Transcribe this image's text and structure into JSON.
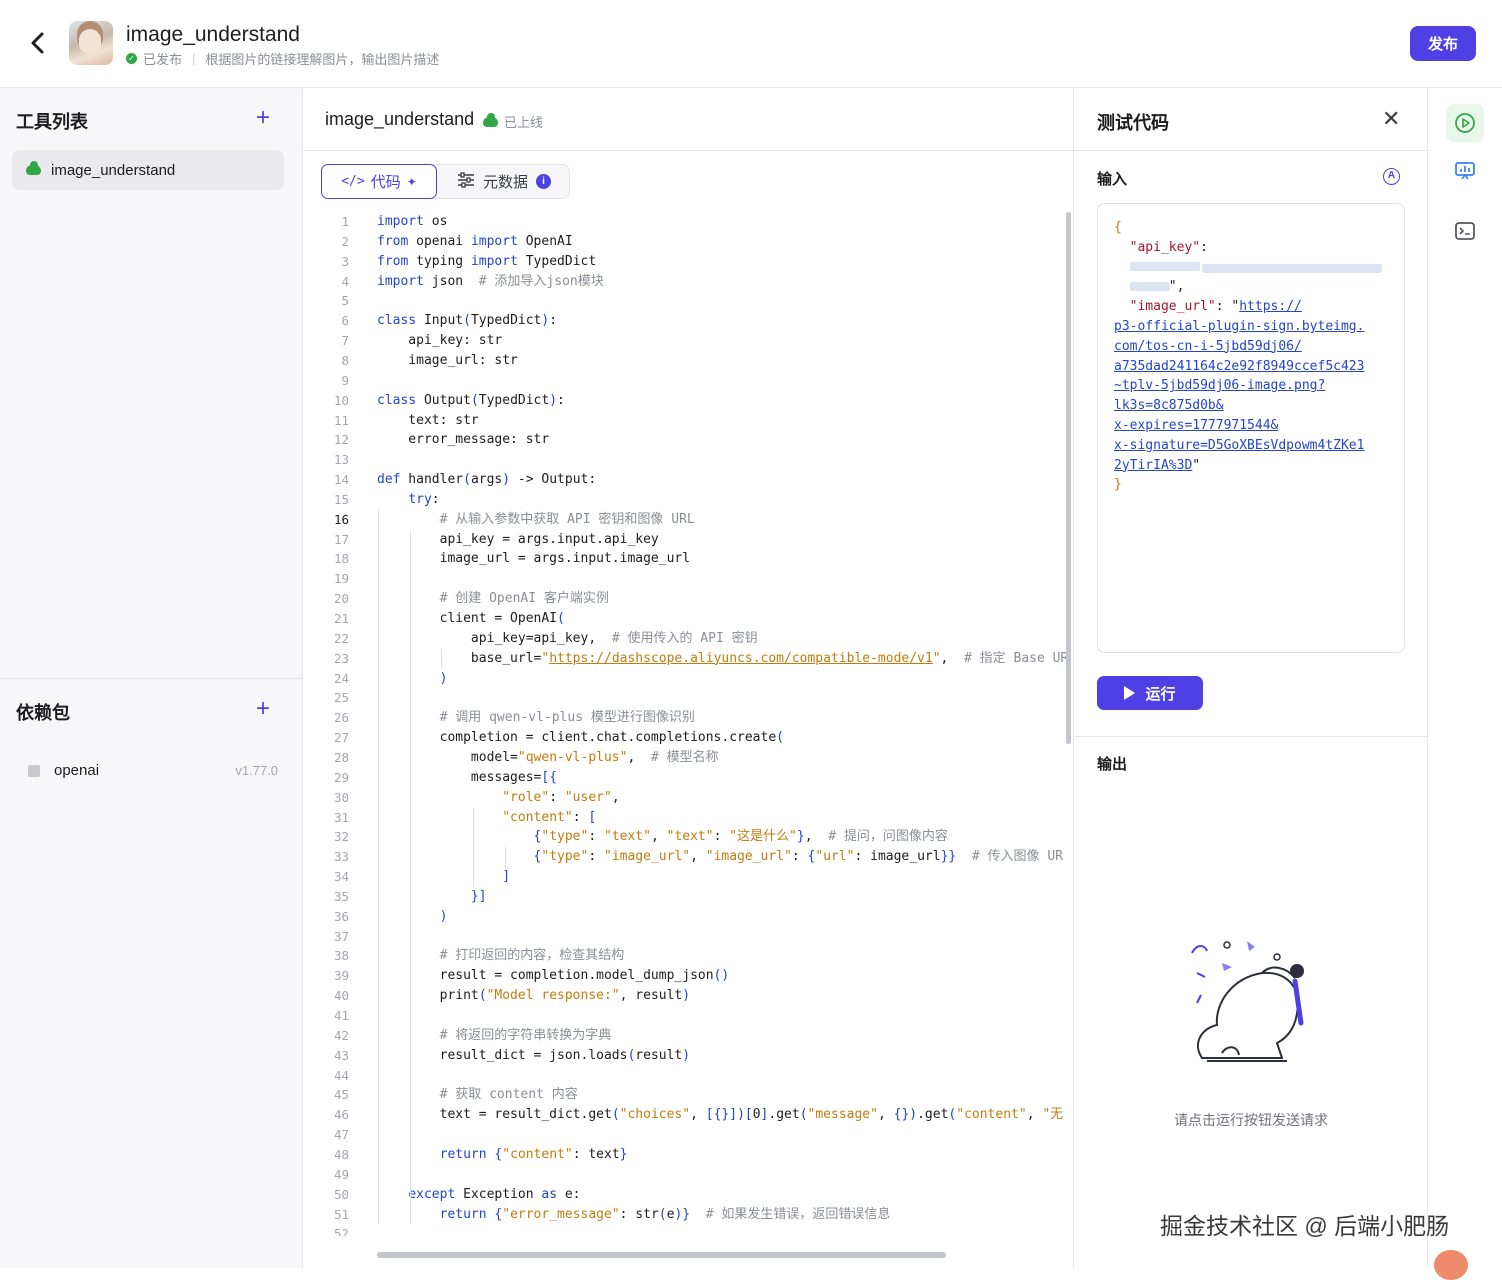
{
  "header": {
    "back_icon": "back-arrow-icon",
    "title": "image_understand",
    "status": "已发布",
    "description": "根据图片的链接理解图片，输出图片描述",
    "publish_label": "发布"
  },
  "sidebar": {
    "tools_title": "工具列表",
    "tools": [
      {
        "label": "image_understand"
      }
    ],
    "deps_title": "依赖包",
    "deps": [
      {
        "name": "openai",
        "version": "v1.77.0"
      }
    ]
  },
  "editor": {
    "title": "image_understand",
    "status": "已上线",
    "tab_code": "代码",
    "tab_meta": "元数据",
    "current_line": 16,
    "lines": [
      "import os",
      "from openai import OpenAI",
      "from typing import TypedDict",
      "import json  # 添加导入json模块",
      "",
      "class Input(TypedDict):",
      "    api_key: str",
      "    image_url: str",
      "",
      "class Output(TypedDict):",
      "    text: str",
      "    error_message: str",
      "",
      "def handler(args) -> Output:",
      "    try:",
      "        # 从输入参数中获取 API 密钥和图像 URL",
      "        api_key = args.input.api_key",
      "        image_url = args.input.image_url",
      "",
      "        # 创建 OpenAI 客户端实例",
      "        client = OpenAI(",
      "            api_key=api_key,  # 使用传入的 API 密钥",
      "            base_url=\"https://dashscope.aliyuncs.com/compatible-mode/v1\",  # 指定 Base UR",
      "        )",
      "",
      "        # 调用 qwen-vl-plus 模型进行图像识别",
      "        completion = client.chat.completions.create(",
      "            model=\"qwen-vl-plus\",  # 模型名称",
      "            messages=[{",
      "                \"role\": \"user\",",
      "                \"content\": [",
      "                    {\"type\": \"text\", \"text\": \"这是什么\"},  # 提问，问图像内容",
      "                    {\"type\": \"image_url\", \"image_url\": {\"url\": image_url}}  # 传入图像 UR",
      "                ]",
      "            }]",
      "        )",
      "",
      "        # 打印返回的内容，检查其结构",
      "        result = completion.model_dump_json()",
      "        print(\"Model response:\", result)",
      "",
      "        # 将返回的字符串转换为字典",
      "        result_dict = json.loads(result)",
      "",
      "        # 获取 content 内容",
      "        text = result_dict.get(\"choices\", [{}])[0].get(\"message\", {}).get(\"content\", \"无",
      "",
      "        return {\"content\": text}",
      "",
      "    except Exception as e:",
      "        return {\"error_message\": str(e)}  # 如果发生错误，返回错误信息",
      ""
    ]
  },
  "test_panel": {
    "title": "测试代码",
    "input_label": "输入",
    "json_lines": [
      "{",
      "  \"api_key\":",
      "",
      "       \",",
      "  \"image_url\": \"https://",
      "p3-official-plugin-sign.byteimg.",
      "com/tos-cn-i-5jbd59dj06/",
      "a735dad241164c2e92f8949ccef5c423",
      "~tplv-5jbd59dj06-image.png?",
      "lk3s=8c875d0b&",
      "x-expires=1777971544&",
      "x-signature=D5GoXBEsVdpowm4tZKe1",
      "2yTirIA%3D\"",
      "}"
    ],
    "run_label": "运行",
    "output_label": "输出",
    "output_hint": "请点击运行按钮发送请求"
  },
  "watermark": "掘金技术社区 @ 后端小肥肠",
  "colors": {
    "accent": "#4e40e5",
    "success": "#32a645",
    "string": "#c27c0e",
    "keyword": "#2245c9"
  }
}
